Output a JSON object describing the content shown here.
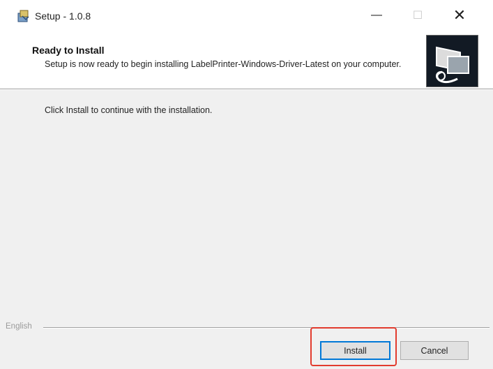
{
  "window": {
    "title": "Setup - 1.0.8",
    "minimize_glyph": "—",
    "maximize_glyph": "☐",
    "close_glyph": "✕"
  },
  "header": {
    "title": "Ready to Install",
    "subtitle": "Setup is now ready to begin installing LabelPrinter-Windows-Driver-Latest on your computer.",
    "image_icon": "installer-computer-icon"
  },
  "body": {
    "message": "Click Install to continue with the installation."
  },
  "footer": {
    "language": "English",
    "install_label": "Install",
    "cancel_label": "Cancel"
  },
  "colors": {
    "highlight": "#e23b2e",
    "focus_border": "#0078d7"
  }
}
